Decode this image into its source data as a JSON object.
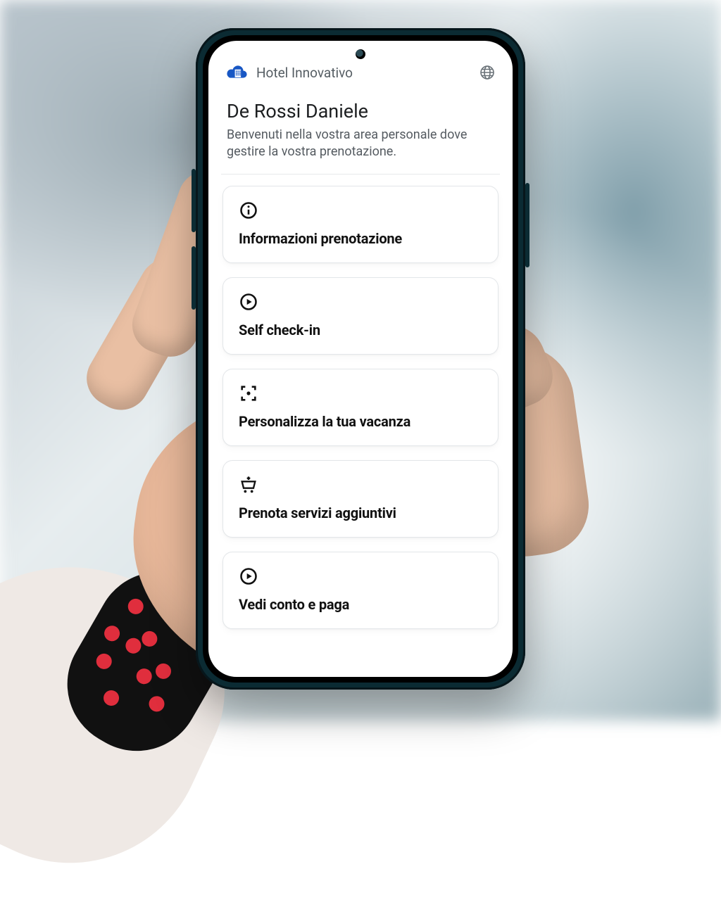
{
  "header": {
    "brand": "Hotel Innovativo",
    "logo_icon": "cloud-building-icon",
    "lang_icon": "globe-icon"
  },
  "user": {
    "name": "De Rossi Daniele",
    "welcome": "Benvenuti nella vostra area personale dove gestire la vostra prenotazione."
  },
  "cards": [
    {
      "icon": "info-icon",
      "title": "Informazioni prenotazione"
    },
    {
      "icon": "play-circle-icon",
      "title": "Self check-in"
    },
    {
      "icon": "center-focus-icon",
      "title": "Personalizza la tua vacanza"
    },
    {
      "icon": "add-cart-icon",
      "title": "Prenota servizi aggiuntivi"
    },
    {
      "icon": "play-circle-icon",
      "title": "Vedi conto e paga"
    }
  ],
  "colors": {
    "brand_blue": "#1857c4",
    "text_muted": "#555b61"
  }
}
